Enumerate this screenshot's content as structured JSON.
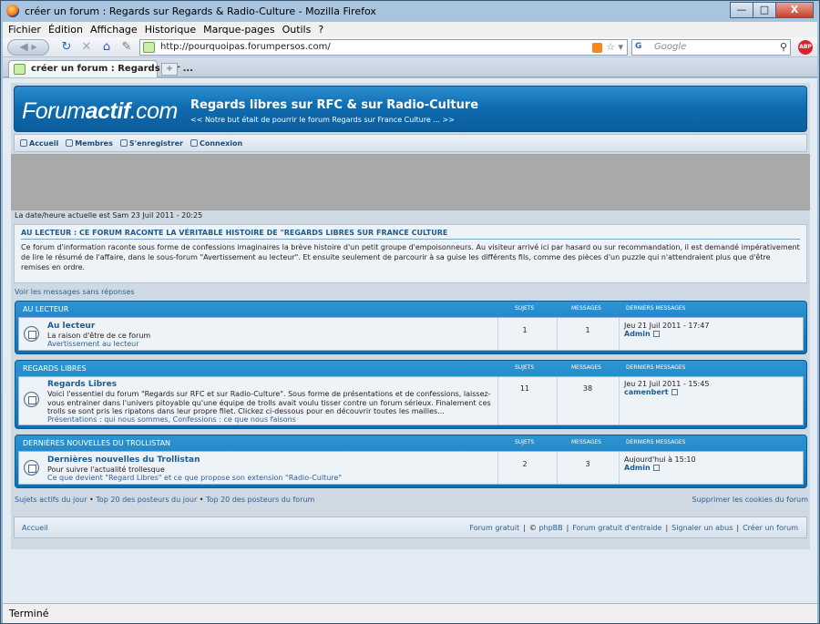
{
  "window": {
    "title": "créer un forum : Regards sur Regards & Radio-Culture - Mozilla Firefox",
    "min": "—",
    "max": "□",
    "close": "X"
  },
  "menu": [
    "Fichier",
    "Édition",
    "Affichage",
    "Historique",
    "Marque-pages",
    "Outils",
    "?"
  ],
  "nav": {
    "url": "http://pourquoipas.forumpersos.com/",
    "search_placeholder": "Google",
    "search_engine": "G",
    "abp": "ABP"
  },
  "tab": {
    "label": "créer un forum : Regards sur ...",
    "new_tab": "+"
  },
  "header": {
    "logo_light": "Forum",
    "logo_bold": "actif",
    "logo_suffix": ".com",
    "title": "Regards libres sur RFC & sur Radio-Culture",
    "subtitle": "<< Notre but était de pourrir le forum Regards sur France Culture ... >>"
  },
  "topnav": [
    "Accueil",
    "Membres",
    "S'enregistrer",
    "Connexion"
  ],
  "datetime": "La date/heure actuelle est Sam 23 Juil 2011 - 20:25",
  "announcement": {
    "title": "AU LECTEUR : CE FORUM RACONTE LA VÉRITABLE HISTOIRE DE \"REGARDS LIBRES SUR FRANCE CULTURE",
    "body": "Ce forum d'information raconte sous forme de confessions imaginaires la brève histoire d'un petit groupe d'empoisonneurs. Au visiteur arrivé ici par hasard ou sur recommandation, il est demandé impérativement de lire le résumé de l'affaire, dans le sous-forum \"Avertissement au lecteur\". Et ensuite seulement de parcourir à sa guise les différents fils, comme des pièces d'un puzzle qui n'attendraient plus que d'être remises en ordre."
  },
  "unanswered": "Voir les messages sans réponses",
  "columns": {
    "topics": "SUJETS",
    "messages": "MESSAGES",
    "last": "DERNIERS MESSAGES"
  },
  "categories": [
    {
      "name": "AU LECTEUR",
      "forum": {
        "name": "Au lecteur",
        "desc": "La raison d'être de ce forum",
        "sub": "Avertissement au lecteur",
        "topics": "1",
        "messages": "1",
        "last_date": "Jeu 21 Juil 2011 - 17:47",
        "last_user": "Admin"
      }
    },
    {
      "name": "REGARDS LIBRES",
      "forum": {
        "name": "Regards Libres",
        "desc": "Voici l'essentiel du forum \"Regards sur RFC et sur Radio-Culture\". Sous forme de présentations et de confessions, laissez-vous entrainer dans l'univers pitoyable qu'une équipe de trolls avait voulu tisser contre un forum sérieux. Finalement ces trolls se sont pris les ripatons dans leur propre filet. Clickez ci-dessous pour en découvrir toutes les mailles...",
        "sub": "Présentations : qui nous sommes, Confessions : ce que nous faisons",
        "topics": "11",
        "messages": "38",
        "last_date": "Jeu 21 Juil 2011 - 15:45",
        "last_user": "camenbert"
      }
    },
    {
      "name": "DERNIÈRES NOUVELLES DU TROLLISTAN",
      "forum": {
        "name": "Dernières nouvelles du Trollistan",
        "desc": "Pour suivre l'actualité trollesque",
        "sub": "Ce que devient \"Regard Libres\" et ce que propose son extension \"Radio-Culture\"",
        "topics": "2",
        "messages": "3",
        "last_date": "Aujourd'hui à 15:10",
        "last_user": "Admin"
      }
    }
  ],
  "bottom": {
    "active": "Sujets actifs du jour",
    "top20_day": "Top 20 des posteurs du jour",
    "top20_forum": "Top 20 des posteurs du forum",
    "bullet": "•",
    "cookies": "Supprimer les cookies du forum"
  },
  "footer": {
    "home": "Accueil",
    "links": [
      "Forum gratuit",
      "©",
      "phpBB",
      "Forum gratuit d'entraide",
      "Signaler un abus",
      "Créer un forum"
    ],
    "sep": "|"
  },
  "status": "Terminé"
}
